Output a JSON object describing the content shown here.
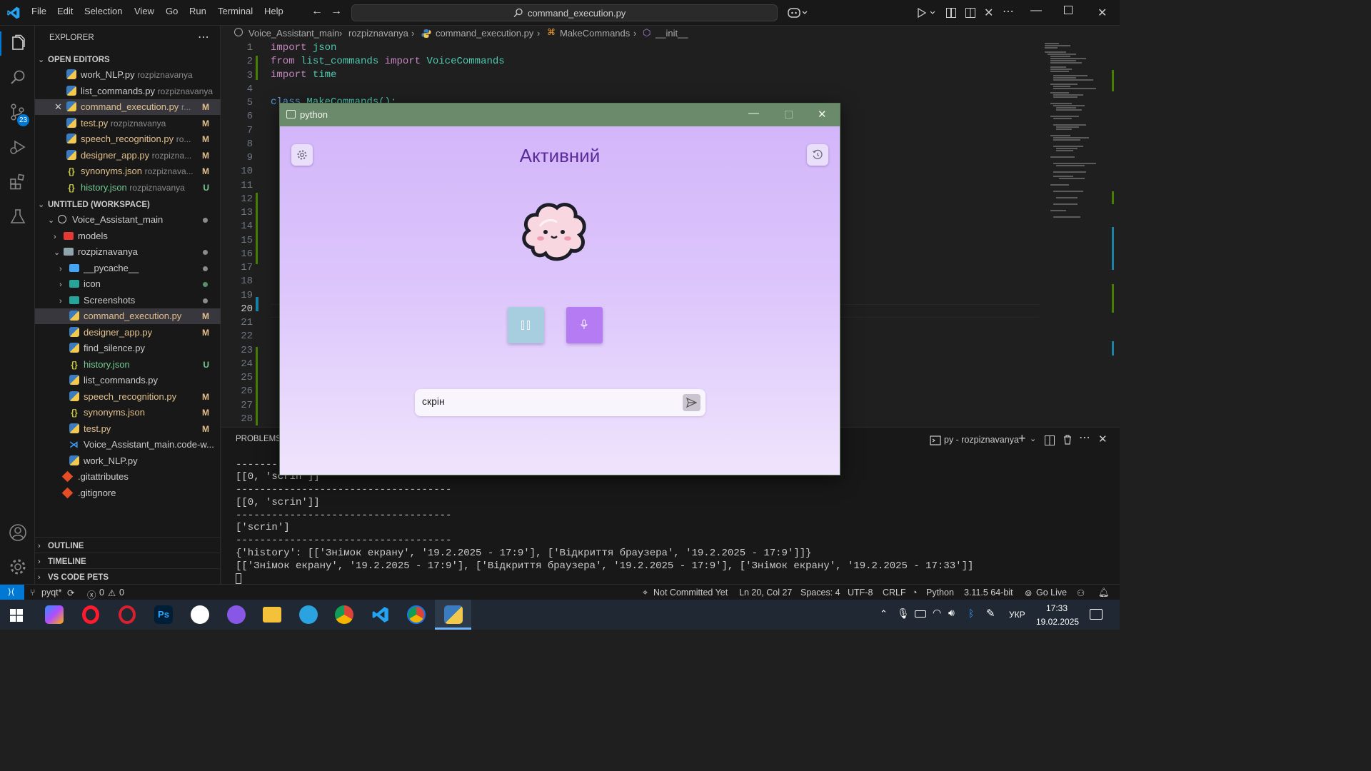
{
  "menu": [
    "File",
    "Edit",
    "Selection",
    "View",
    "Go",
    "Run",
    "Terminal",
    "Help"
  ],
  "search": {
    "text": "command_execution.py"
  },
  "breadcrumb": [
    "Voice_Assistant_main",
    "rozpiznavanya",
    "command_execution.py",
    "MakeCommands",
    "__init__"
  ],
  "scm_badge": "23",
  "sidebar": {
    "title": "EXPLORER",
    "open_editors_header": "OPEN EDITORS",
    "open_editors": [
      {
        "name": "work_NLP.py",
        "path": "rozpiznavanya",
        "badge": ""
      },
      {
        "name": "list_commands.py",
        "path": "rozpiznavanya",
        "badge": ""
      },
      {
        "name": "command_execution.py",
        "path": "r...",
        "badge": "M"
      },
      {
        "name": "test.py",
        "path": "rozpiznavanya",
        "badge": "M"
      },
      {
        "name": "speech_recognition.py",
        "path": "ro...",
        "badge": "M"
      },
      {
        "name": "designer_app.py",
        "path": "rozpizna...",
        "badge": "M"
      },
      {
        "name": "synonyms.json",
        "path": "rozpiznava...",
        "badge": "M"
      },
      {
        "name": "history.json",
        "path": "rozpiznavanya",
        "badge": "U"
      }
    ],
    "workspace_header": "UNTITLED (WORKSPACE)",
    "tree": [
      {
        "name": "Voice_Assistant_main"
      },
      {
        "name": "models"
      },
      {
        "name": "rozpiznavanya"
      },
      {
        "name": "__pycache__"
      },
      {
        "name": "icon"
      },
      {
        "name": "Screenshots"
      },
      {
        "name": "command_execution.py",
        "badge": "M"
      },
      {
        "name": "designer_app.py",
        "badge": "M"
      },
      {
        "name": "find_silence.py",
        "badge": ""
      },
      {
        "name": "history.json",
        "badge": "U"
      },
      {
        "name": "list_commands.py",
        "badge": ""
      },
      {
        "name": "speech_recognition.py",
        "badge": "M"
      },
      {
        "name": "synonyms.json",
        "badge": "M"
      },
      {
        "name": "test.py",
        "badge": "M"
      },
      {
        "name": "Voice_Assistant_main.code-w...",
        "badge": ""
      },
      {
        "name": "work_NLP.py",
        "badge": ""
      },
      {
        "name": ".gitattributes",
        "badge": ""
      },
      {
        "name": ".gitignore",
        "badge": ""
      }
    ],
    "outline": "OUTLINE",
    "timeline": "TIMELINE",
    "vscode_pets": "VS CODE PETS"
  },
  "editor": {
    "line_numbers": [
      "1",
      "2",
      "3",
      "4",
      "5",
      "6",
      "7",
      "8",
      "9",
      "10",
      "11",
      "12",
      "13",
      "14",
      "15",
      "16",
      "17",
      "18",
      "19",
      "20",
      "21",
      "22",
      "23",
      "24",
      "25",
      "26",
      "27",
      "28"
    ],
    "current_line": "20",
    "line1": {
      "kw": "import",
      "mod": "json"
    },
    "line2": {
      "kw1": "from",
      "mod1": "list_commands",
      "kw2": "import",
      "mod2": "VoiceCommands"
    },
    "line3": {
      "kw": "import",
      "mod": "time"
    },
    "line5": {
      "kw": "class",
      "name": "MakeCommands():"
    }
  },
  "panel": {
    "tab": "PROBLEMS",
    "terminal_name": "py - rozpiznavanya",
    "lines": [
      "------------------------------------",
      "[[0, 'scrin']]",
      "------------------------------------",
      "[[0, 'scrin']]",
      "------------------------------------",
      "['scrin']",
      "------------------------------------",
      "{'history': [['Знімок екрану', '19.2.2025 - 17:9'], ['Відкриття браузера', '19.2.2025 - 17:9']]}",
      "[['Знімок екрану', '19.2.2025 - 17:9'], ['Відкриття браузера', '19.2.2025 - 17:9'], ['Знімок екрану', '19.2.2025 - 17:33']]"
    ]
  },
  "statusbar": {
    "branch": "pyqt*",
    "errors": "0",
    "warnings": "0",
    "not_committed": "Not Committed Yet",
    "position": "Ln 20, Col 27",
    "spaces": "Spaces: 4",
    "encoding": "UTF-8",
    "eol": "CRLF",
    "language": "Python",
    "interpreter": "3.11.5 64-bit",
    "golive": "Go Live"
  },
  "pywin": {
    "title": "python",
    "status": "Активний",
    "input_value": "скрін"
  },
  "taskbar": {
    "lang": "УКР",
    "time": "17:33",
    "date": "19.02.2025"
  },
  "colors": {
    "accent": "#0078d4",
    "window_title": "#6b8a6b",
    "pause_button": "#a6cede",
    "mic_button": "#b57bf2",
    "status_text": "#5b2b9a"
  }
}
